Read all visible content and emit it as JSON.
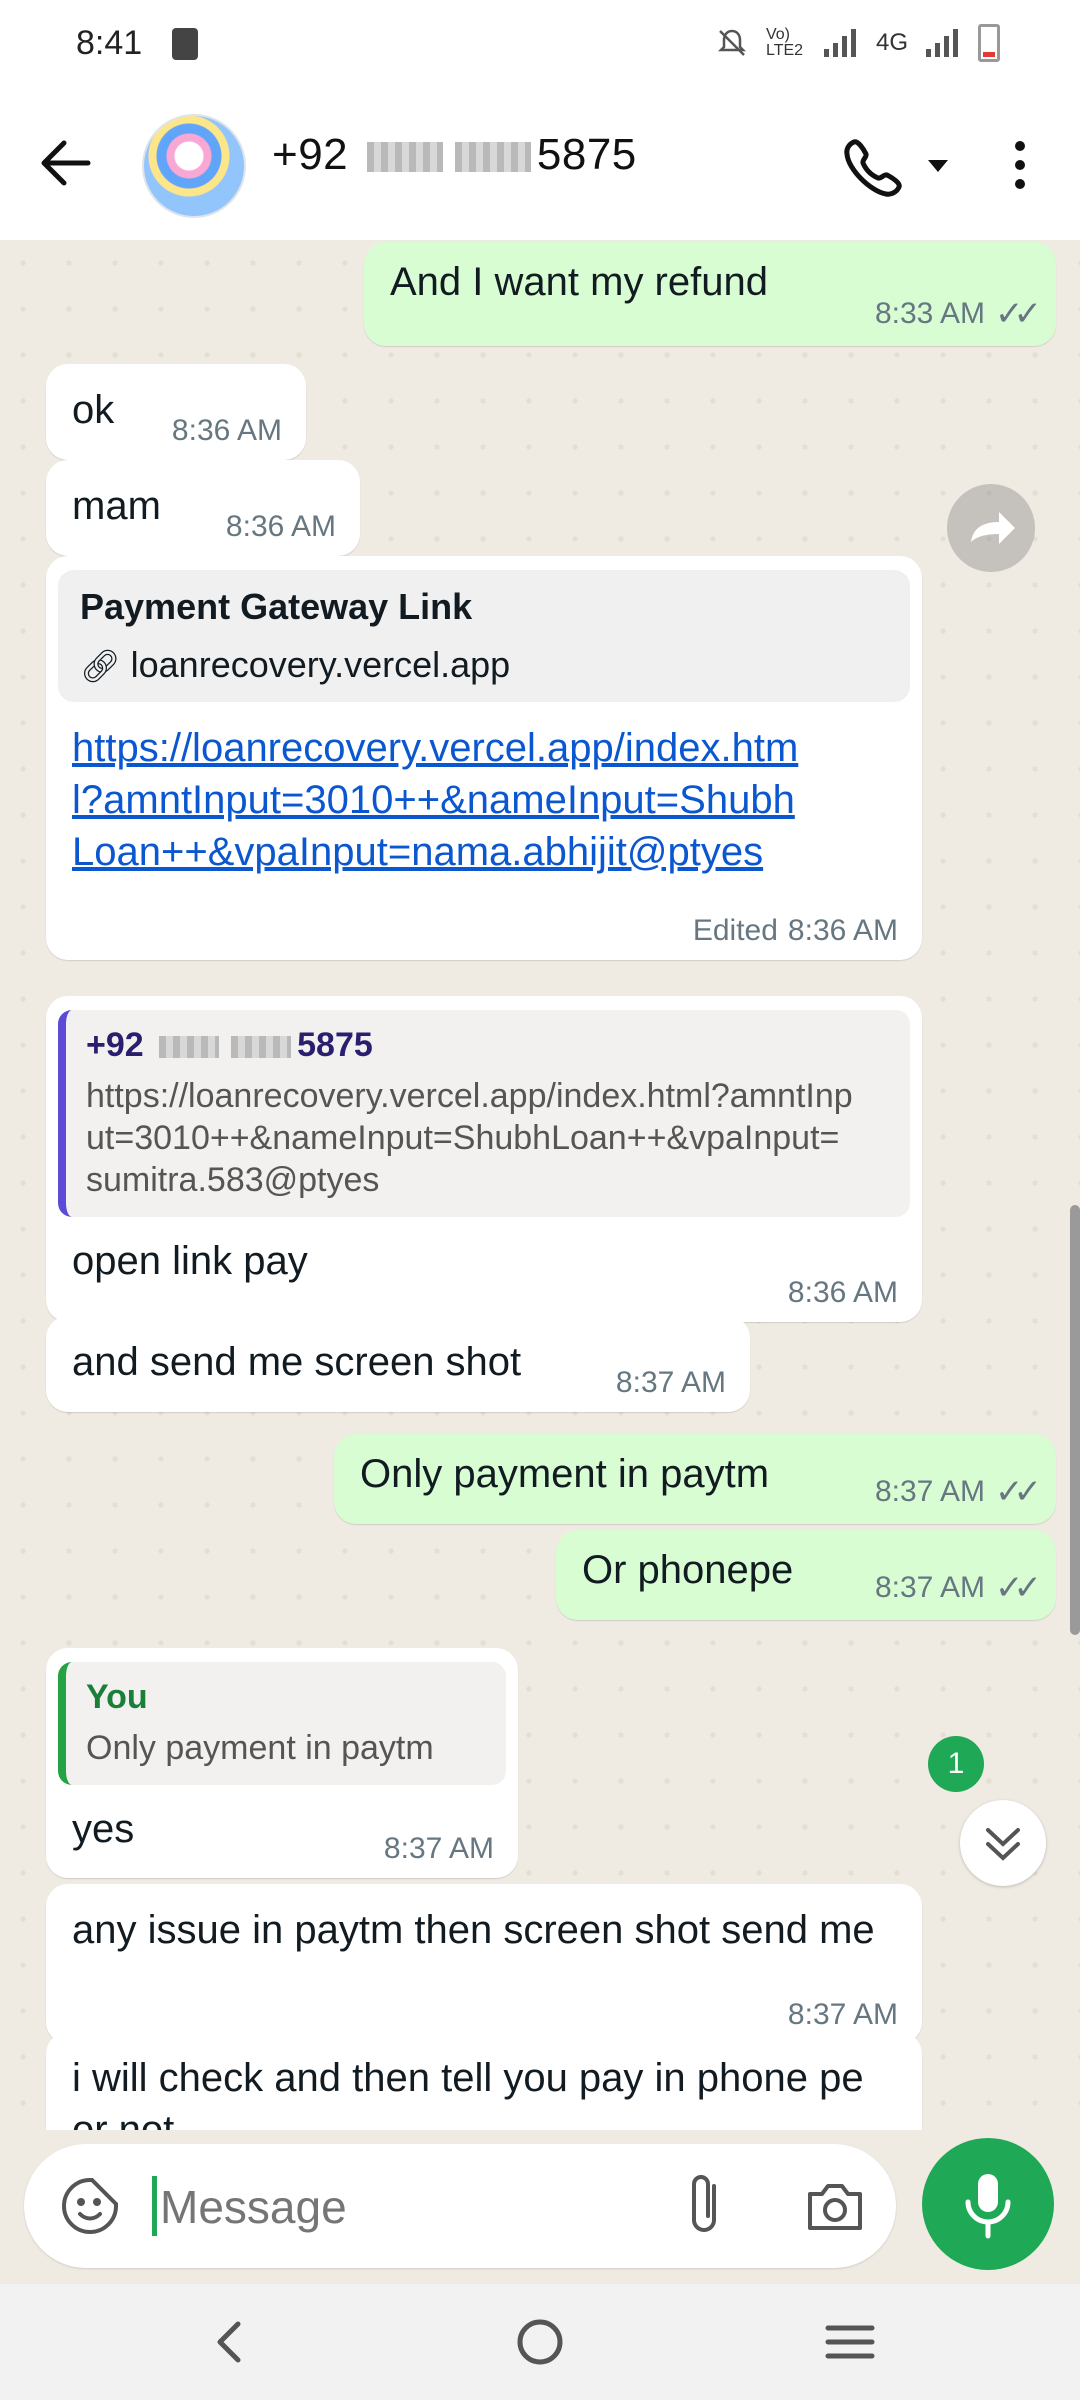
{
  "status": {
    "time": "8:41",
    "network": "4G",
    "volte": "Vo) LTE2"
  },
  "header": {
    "contact_prefix": "+92",
    "contact_suffix": "5875"
  },
  "messages": [
    {
      "dir": "out",
      "text": "And I want my refund",
      "time": "8:33 AM"
    },
    {
      "dir": "in",
      "text": "ok",
      "time": "8:36 AM"
    },
    {
      "dir": "in",
      "text": "mam",
      "time": "8:36 AM"
    },
    {
      "dir": "in",
      "preview_title": "Payment Gateway Link",
      "preview_domain": "loanrecovery.vercel.app",
      "link": "https://loanrecovery.vercel.app/index.html?amntInput=3010++&nameInput=ShubhLoan++&vpaInput=nama.abhijit@ptyes",
      "edited": "Edited",
      "time": "8:36 AM"
    },
    {
      "dir": "in",
      "quote_name_prefix": "+92",
      "quote_name_suffix": "5875",
      "quote_text": "https://loanrecovery.vercel.app/index.html?amntInput=3010++&nameInput=ShubhLoan++&vpaInput=sumitra.583@ptyes",
      "text": "open link pay",
      "time": "8:36 AM"
    },
    {
      "dir": "in",
      "text": "and send me screen shot",
      "time": "8:37 AM"
    },
    {
      "dir": "out",
      "text": "Only payment in paytm",
      "time": "8:37 AM"
    },
    {
      "dir": "out",
      "text": "Or phonepe",
      "time": "8:37 AM"
    },
    {
      "dir": "in",
      "quote_name": "You",
      "quote_text": "Only payment in paytm",
      "text": "yes",
      "time": "8:37 AM"
    },
    {
      "dir": "in",
      "text": "any issue in paytm then screen shot send me",
      "time": "8:37 AM"
    },
    {
      "dir": "in",
      "text": "i will check and then tell you pay in phone pe or not",
      "time": ""
    }
  ],
  "unread_badge": "1",
  "composer": {
    "placeholder": "Message"
  },
  "colors": {
    "outgoing": "#d9fdd3",
    "incoming": "#ffffff",
    "accent": "#1fa855",
    "link": "#0b57d0"
  },
  "icons": [
    "back-arrow-icon",
    "phone-icon",
    "dropdown-icon",
    "more-vert-icon",
    "forward-icon",
    "double-chevron-down-icon",
    "sticker-icon",
    "attach-icon",
    "camera-icon",
    "mic-icon",
    "nav-back-icon",
    "nav-home-icon",
    "nav-recents-icon"
  ]
}
